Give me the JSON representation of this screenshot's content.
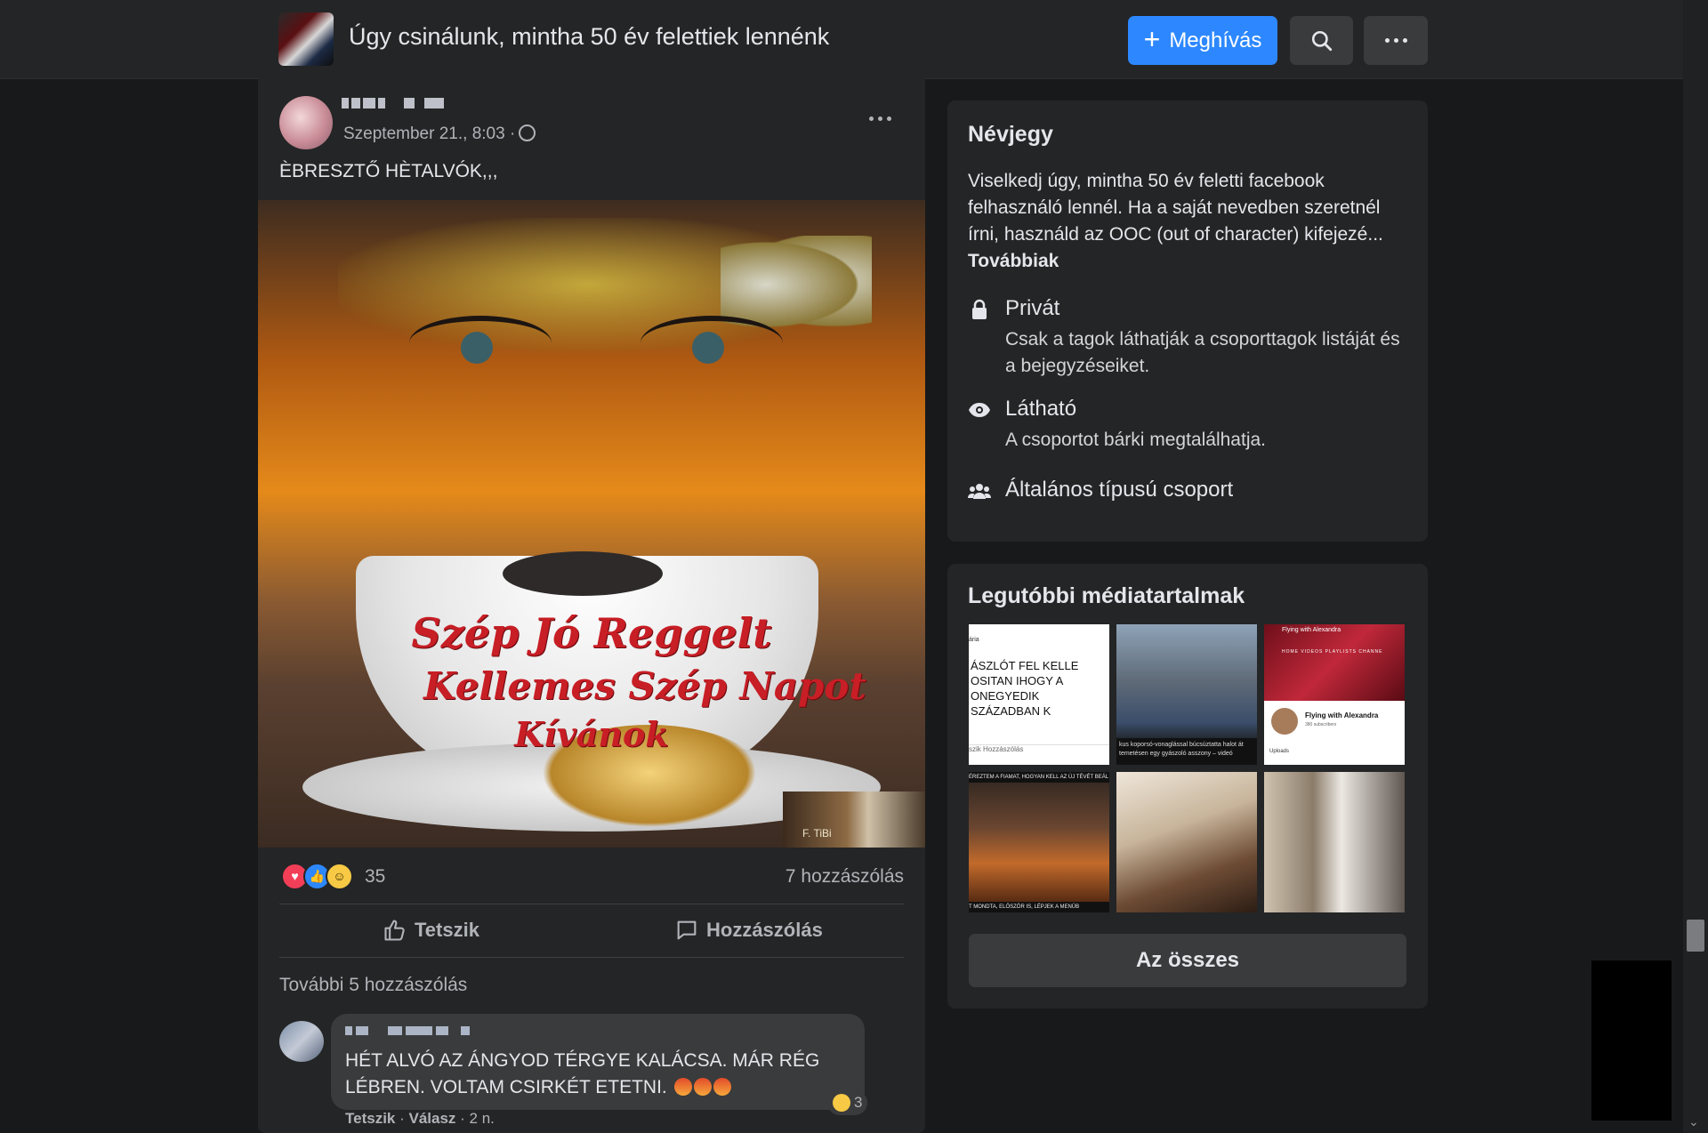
{
  "header": {
    "group_title": "Úgy csinálunk, mintha 50 év felettiek lennénk",
    "invite_label": "Meghívás"
  },
  "post": {
    "date": "Szeptember 21., 8:03 ·",
    "text": "ÈBRESZTŐ HÈTALVÓK,,,",
    "image_text": {
      "line1": "Szép Jó Reggelt",
      "line2": "Kellemes Szép Napot",
      "line3": "Kívánok",
      "sticker": "F. TiBi"
    },
    "reaction_count": "35",
    "comment_count": "7 hozzászólás",
    "like_label": "Tetszik",
    "comment_label": "Hozzászólás",
    "more_comments": "További 5 hozzászólás",
    "comment": {
      "text": "HÉT ALVÓ AZ ÁNGYOD TÉRGYE KALÁCSA. MÁR RÉG LÉBREN. VOLTAM CSIRKÉT ETETNI.",
      "reaction_count": "3",
      "like": "Tetszik",
      "reply": "Válasz",
      "age": "2 n."
    }
  },
  "about": {
    "title": "Névjegy",
    "description": "Viselkedj úgy, mintha 50 év feletti facebook felhasználó lennél. Ha a saját nevedben szeretnél írni, használd az OOC (out of character) kifejezé...",
    "more": "Továbbiak",
    "private_label": "Privát",
    "private_sub": "Csak a tagok láthatják a csoporttagok listáját és a bejegyzéseiket.",
    "visible_label": "Látható",
    "visible_sub": "A csoportot bárki megtalálhatja.",
    "type_label": "Általános típusú csoport"
  },
  "media": {
    "title": "Legutóbbi médiatartalmak",
    "t1_top": "ária",
    "t1_text": "ÁSZLÓT FEL KELLE OSITAN IHOGY A ONEGYEDIK SZÁZADBAN K",
    "t1_bar": "szik      Hozzászólás",
    "t2_caption": "kus koporsó-vonaglással búcsúztatta halot át temetésen egy gyászoló asszony – videó",
    "t3_channel": "Flying with Alexandra",
    "t3_nav": "HOME  VIDEOS  PLAYLISTS  CHANNE",
    "t3_name": "Flying with Alexandra",
    "t3_subs": "380 subscribers",
    "t3_uploads": "Uploads",
    "t4_top": "ÉREZTEM A FIAMAT, HOGYAN KELL AZ ÚJ TÉVÉT BEÁL",
    "t4_bottom": "T MONDTA, ELŐSZÖR IS, LÉPJEK A MENÜB",
    "all_label": "Az összes"
  },
  "colors": {
    "background": "#18191a",
    "surface": "#242526",
    "accent": "#2d88ff"
  }
}
